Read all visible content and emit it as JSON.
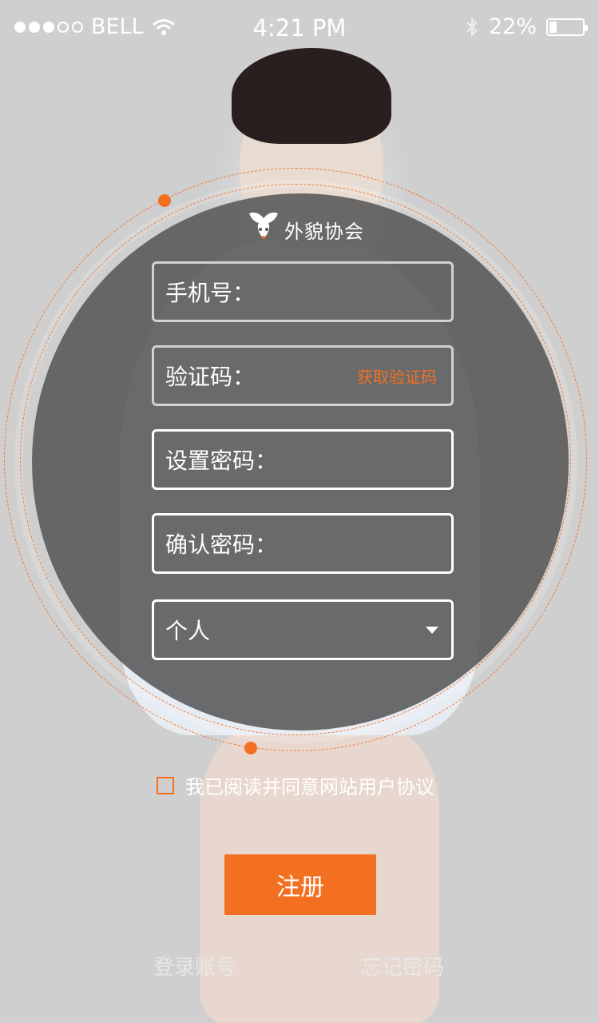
{
  "status_bar": {
    "carrier": "BELL",
    "time": "4:21 PM",
    "battery": "22%",
    "battery_level": 0.22,
    "signal_bars": 3
  },
  "logo": {
    "text": "外貌协会"
  },
  "form": {
    "phone_label": "手机号：",
    "code_label": "验证码：",
    "get_code": "获取验证码",
    "password_label": "设置密码：",
    "confirm_label": "确认密码：",
    "account_type": "个人"
  },
  "agreement": {
    "text": "我已阅读并同意网站用户协议",
    "checked": false
  },
  "register_button": "注册",
  "links": {
    "login": "登录账号",
    "forgot": "忘记密码"
  },
  "colors": {
    "accent": "#f37021",
    "circle": "#585858"
  }
}
